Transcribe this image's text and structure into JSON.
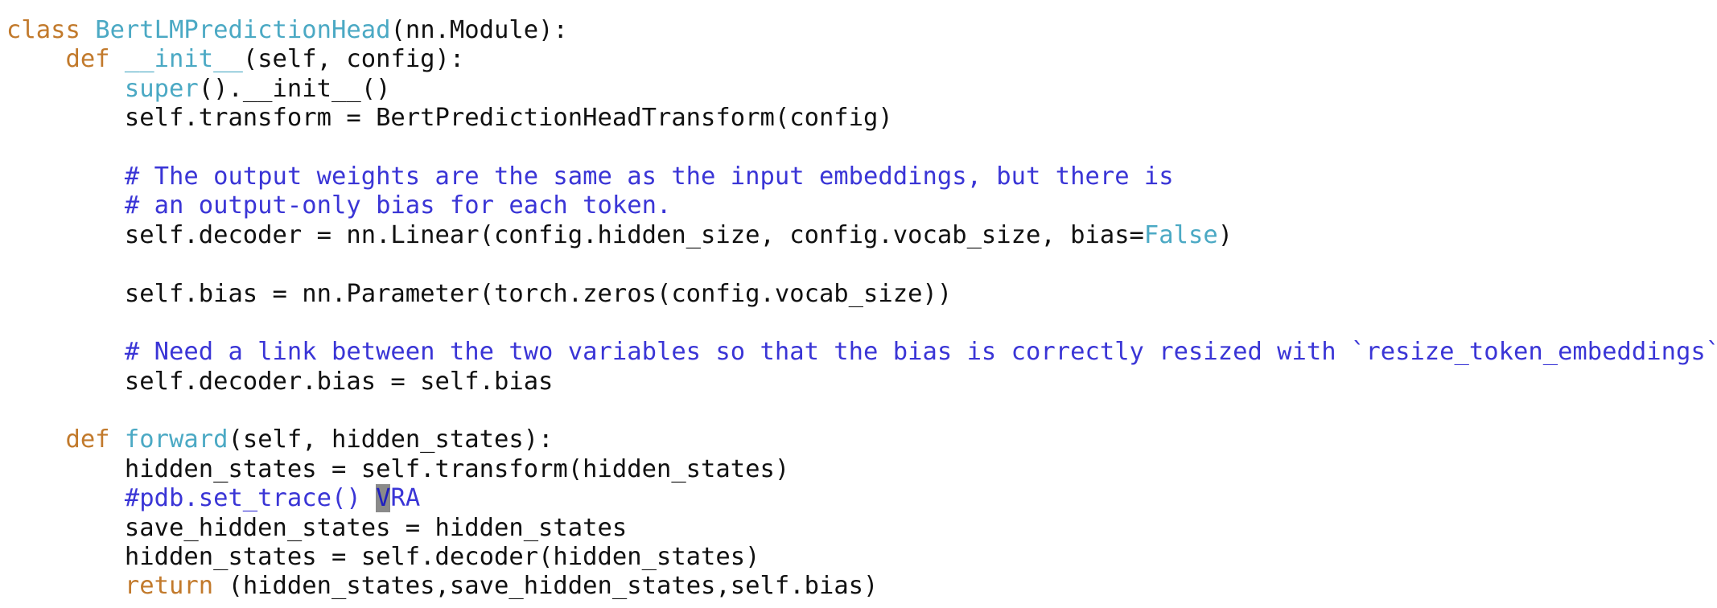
{
  "editor": {
    "language": "python",
    "cursor_line": 17,
    "colors": {
      "keyword": "#c27a2c",
      "class_name": "#4ba9c4",
      "function_name": "#4ba9c4",
      "builtin": "#4ba9c4",
      "constant": "#4ba9c4",
      "comment": "#3a35d6",
      "text": "#111111",
      "background": "#ffffff",
      "cursor": "#8a8a8a"
    },
    "lines": [
      [
        {
          "t": "kw",
          "v": "class"
        },
        {
          "t": "txt",
          "v": " "
        },
        {
          "t": "cls",
          "v": "BertLMPredictionHead"
        },
        {
          "t": "txt",
          "v": "(nn.Module):"
        }
      ],
      [
        {
          "t": "txt",
          "v": "    "
        },
        {
          "t": "kw",
          "v": "def"
        },
        {
          "t": "txt",
          "v": " "
        },
        {
          "t": "fn",
          "v": "__init__"
        },
        {
          "t": "txt",
          "v": "(self, config):"
        }
      ],
      [
        {
          "t": "txt",
          "v": "        "
        },
        {
          "t": "bi",
          "v": "super"
        },
        {
          "t": "txt",
          "v": "().__init__()"
        }
      ],
      [
        {
          "t": "txt",
          "v": "        self.transform = BertPredictionHeadTransform(config)"
        }
      ],
      [],
      [
        {
          "t": "txt",
          "v": "        "
        },
        {
          "t": "cm",
          "v": "# The output weights are the same as the input embeddings, but there is"
        }
      ],
      [
        {
          "t": "txt",
          "v": "        "
        },
        {
          "t": "cm",
          "v": "# an output-only bias for each token."
        }
      ],
      [
        {
          "t": "txt",
          "v": "        self.decoder = nn.Linear(config.hidden_size, config.vocab_size, bias="
        },
        {
          "t": "const",
          "v": "False"
        },
        {
          "t": "txt",
          "v": ")"
        }
      ],
      [],
      [
        {
          "t": "txt",
          "v": "        self.bias = nn.Parameter(torch.zeros(config.vocab_size))"
        }
      ],
      [],
      [
        {
          "t": "txt",
          "v": "        "
        },
        {
          "t": "cm",
          "v": "# Need a link between the two variables so that the bias is correctly resized with `resize_token_embeddings`"
        }
      ],
      [
        {
          "t": "txt",
          "v": "        self.decoder.bias = self.bias"
        }
      ],
      [],
      [
        {
          "t": "txt",
          "v": "    "
        },
        {
          "t": "kw",
          "v": "def"
        },
        {
          "t": "txt",
          "v": " "
        },
        {
          "t": "fn",
          "v": "forward"
        },
        {
          "t": "txt",
          "v": "(self, hidden_states):"
        }
      ],
      [
        {
          "t": "txt",
          "v": "        hidden_states = self.transform(hidden_states)"
        }
      ],
      [
        {
          "t": "txt",
          "v": "        "
        },
        {
          "t": "cm",
          "v": "#pdb.set_trace() "
        },
        {
          "t": "cursor",
          "v": "V"
        },
        {
          "t": "cm",
          "v": "RA"
        }
      ],
      [
        {
          "t": "txt",
          "v": "        save_hidden_states = hidden_states"
        }
      ],
      [
        {
          "t": "txt",
          "v": "        hidden_states = self.decoder(hidden_states)"
        }
      ],
      [
        {
          "t": "txt",
          "v": "        "
        },
        {
          "t": "kw",
          "v": "return"
        },
        {
          "t": "txt",
          "v": " (hidden_states,save_hidden_states,self.bias)"
        }
      ]
    ]
  }
}
